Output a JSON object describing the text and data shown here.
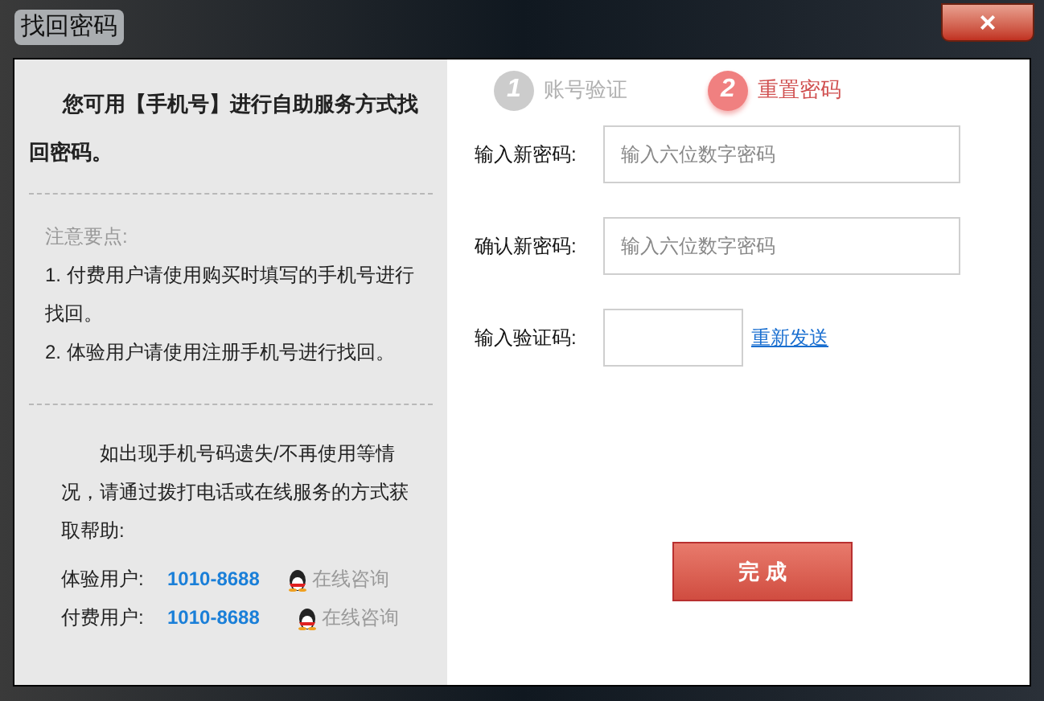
{
  "window": {
    "title": "找回密码",
    "close": "×"
  },
  "left": {
    "intro": "您可用【手机号】进行自助服务方式找回密码。",
    "notes_title": "注意要点:",
    "notes": [
      "1. 付费用户请使用购买时填写的手机号进行找回。",
      "2. 体验用户请使用注册手机号进行找回。"
    ],
    "help": "如出现手机号码遗失/不再使用等情况，请通过拨打电话或在线服务的方式获取帮助:",
    "contacts": [
      {
        "label": "体验用户:",
        "phone": "1010-8688",
        "link": "在线咨询"
      },
      {
        "label": "付费用户:",
        "phone": "1010-8688",
        "link": "在线咨询"
      }
    ]
  },
  "steps": [
    {
      "number": "1",
      "label": "账号验证",
      "selected": false
    },
    {
      "number": "2",
      "label": "重置密码",
      "selected": true
    }
  ],
  "fields": [
    {
      "label": "输入新密码:",
      "placeholder": "输入六位数字密码",
      "kind": "wide"
    },
    {
      "label": "确认新密码:",
      "placeholder": "输入六位数字密码",
      "kind": "wide"
    },
    {
      "label": "输入验证码:",
      "kind": "short",
      "link": "重新发送"
    }
  ],
  "submit": "完 成"
}
